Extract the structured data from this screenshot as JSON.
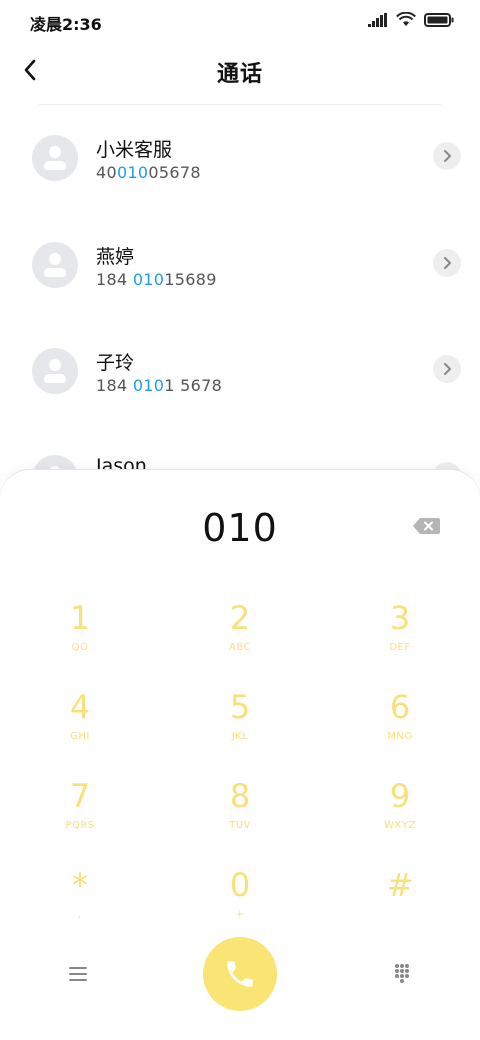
{
  "status_bar": {
    "time": "凌晨2:36"
  },
  "header": {
    "title": "通话"
  },
  "contacts": [
    {
      "name": "小米客服",
      "number_pre": "40",
      "number_hl": "010",
      "number_post": "05678"
    },
    {
      "name": "燕婷",
      "number_pre": "184 ",
      "number_hl": "010",
      "number_post": "15689"
    },
    {
      "name": "子玲",
      "number_pre": "184 ",
      "number_hl": "010",
      "number_post": "1 5678"
    },
    {
      "name": "Jason",
      "number_pre": "",
      "number_hl": "",
      "number_post": ""
    }
  ],
  "dialer": {
    "input": "010",
    "keys": [
      {
        "digit": "1",
        "letters": "QO"
      },
      {
        "digit": "2",
        "letters": "ABC"
      },
      {
        "digit": "3",
        "letters": "DEF"
      },
      {
        "digit": "4",
        "letters": "GHI"
      },
      {
        "digit": "5",
        "letters": "JKL"
      },
      {
        "digit": "6",
        "letters": "MNO"
      },
      {
        "digit": "7",
        "letters": "PQRS"
      },
      {
        "digit": "8",
        "letters": "TUV"
      },
      {
        "digit": "9",
        "letters": "WXYZ"
      },
      {
        "digit": "*",
        "letters": ","
      },
      {
        "digit": "0",
        "letters": "+"
      },
      {
        "digit": "#",
        "letters": ""
      }
    ]
  },
  "colors": {
    "accent_yellow": "#fae473",
    "key_text": "#f8e07a",
    "highlight_blue": "#1aa0e0"
  },
  "icons": {
    "back": "chevron-left-icon",
    "detail": "chevron-right-icon",
    "backspace": "backspace-icon",
    "menu": "menu-icon",
    "call": "phone-icon",
    "keypad": "keypad-icon"
  }
}
